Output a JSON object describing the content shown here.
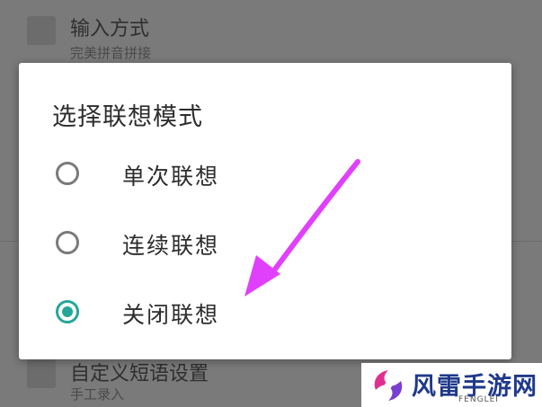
{
  "background": {
    "rows": [
      {
        "title": "输入方式",
        "subtitle": "完美拼音拼接"
      },
      {
        "title": "自定义短语设置",
        "subtitle": "手工录入"
      }
    ]
  },
  "dialog": {
    "title": "选择联想模式",
    "options": [
      {
        "label": "单次联想",
        "checked": false
      },
      {
        "label": "连续联想",
        "checked": false
      },
      {
        "label": "关闭联想",
        "checked": true
      }
    ]
  },
  "watermark": {
    "name": "风雷手游网",
    "sub": "FENGLEI"
  },
  "colors": {
    "accent": "#26a69a",
    "annotation_arrow": "#e040fb"
  }
}
